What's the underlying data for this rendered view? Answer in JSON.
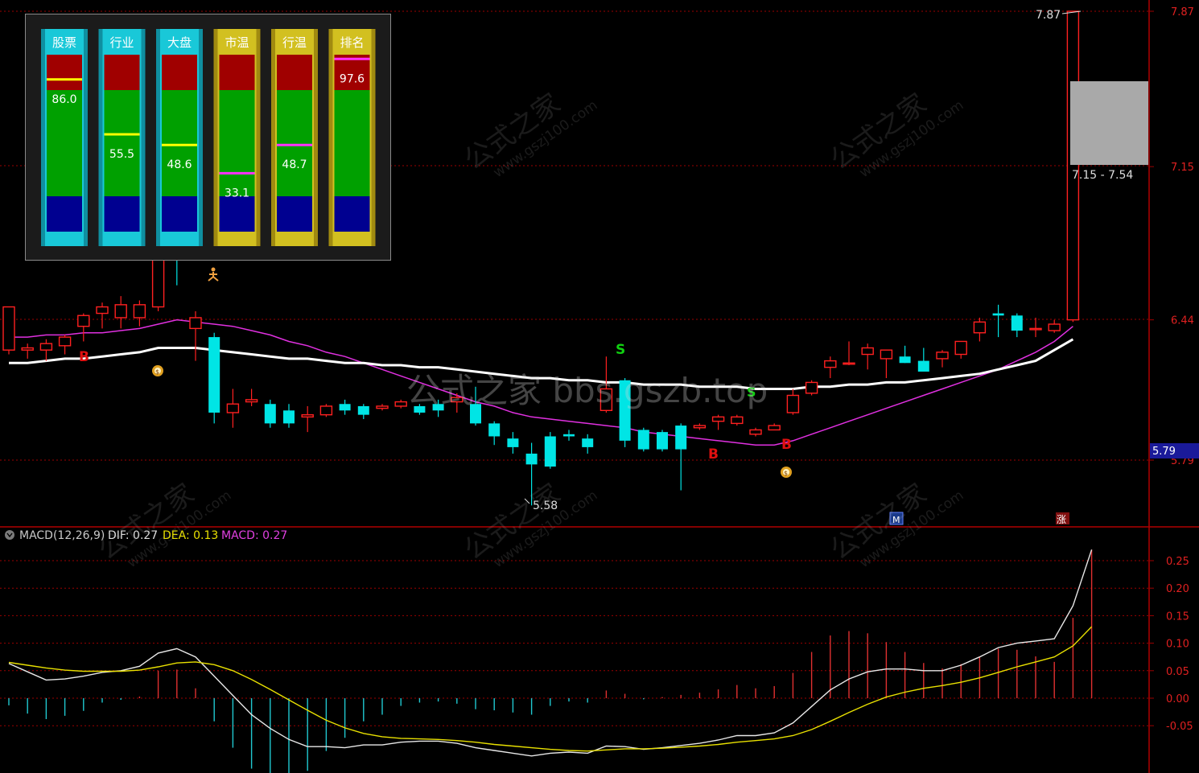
{
  "colors": {
    "background": "#000000",
    "up": "#ff2020",
    "down": "#00e5e5",
    "grid": "#9b0000",
    "ma_white": "#ffffff",
    "ma_magenta": "#e030e0",
    "dea": "#e8e000",
    "macd_label": "#e040e0"
  },
  "price_axis": {
    "ticks": [
      "7.87",
      "7.15",
      "6.44",
      "5.79"
    ],
    "current": "5.79",
    "ylim": [
      5.3,
      7.95
    ]
  },
  "annotations": {
    "high": "7.87",
    "range": "7.15 - 7.54",
    "low": "5.58",
    "zhang": "涨",
    "m_marker": "M"
  },
  "signals": [
    "B",
    "B",
    "B",
    "S",
    "S"
  ],
  "gauges": [
    {
      "label": "股票",
      "value": "86.0",
      "theme": "cyan",
      "level": 0.86,
      "line": "yellow"
    },
    {
      "label": "行业",
      "value": "55.5",
      "theme": "cyan",
      "level": 0.55,
      "line": "yellow"
    },
    {
      "label": "大盘",
      "value": "48.6",
      "theme": "cyan",
      "level": 0.49,
      "line": "yellow"
    },
    {
      "label": "市温",
      "value": "33.1",
      "theme": "gold",
      "level": 0.33,
      "line": "magenta"
    },
    {
      "label": "行温",
      "value": "48.7",
      "theme": "gold",
      "level": 0.49,
      "line": "magenta"
    },
    {
      "label": "排名",
      "value": "97.6",
      "theme": "gold",
      "level": 0.976,
      "line": "magenta"
    }
  ],
  "macd_header": {
    "name": "MACD(12,26,9)",
    "dif": "DIF: 0.27",
    "dea": "DEA: 0.13",
    "macd": "MACD: 0.27"
  },
  "macd_axis": {
    "ticks": [
      "0.25",
      "0.20",
      "0.15",
      "0.10",
      "0.05",
      "0.00",
      "-0.05"
    ],
    "ylim": [
      -0.13,
      0.29
    ]
  },
  "watermark": {
    "cn": "公式之家",
    "url": "www.gszj100.com",
    "center": "公式之家 bbs.gszb.top"
  },
  "chart_data": [
    {
      "type": "candlestick",
      "x": [
        1,
        2,
        3,
        4,
        5,
        6,
        7,
        8,
        9,
        10,
        11,
        12,
        13,
        14,
        15,
        16,
        17,
        18,
        19,
        20,
        21,
        22,
        23,
        24,
        25,
        26,
        27,
        28,
        29,
        30,
        31,
        32,
        33,
        34,
        35,
        36,
        37,
        38,
        39,
        40,
        41,
        42,
        43,
        44,
        45,
        46,
        47,
        48,
        49,
        50,
        51,
        52,
        53,
        54,
        55,
        56,
        57,
        58
      ],
      "ohlc": [
        [
          6.3,
          6.5,
          6.28,
          6.5
        ],
        [
          6.3,
          6.33,
          6.26,
          6.31
        ],
        [
          6.3,
          6.35,
          6.25,
          6.33
        ],
        [
          6.32,
          6.37,
          6.28,
          6.36
        ],
        [
          6.41,
          6.47,
          6.34,
          6.46
        ],
        [
          6.47,
          6.52,
          6.4,
          6.5
        ],
        [
          6.45,
          6.55,
          6.4,
          6.51
        ],
        [
          6.45,
          6.53,
          6.41,
          6.51
        ],
        [
          6.5,
          6.9,
          6.48,
          6.85
        ],
        [
          6.82,
          6.88,
          6.6,
          6.8
        ],
        [
          6.4,
          6.48,
          6.25,
          6.45
        ],
        [
          6.36,
          6.38,
          5.96,
          6.01
        ],
        [
          6.01,
          6.12,
          5.94,
          6.05
        ],
        [
          6.06,
          6.12,
          6.04,
          6.07
        ],
        [
          6.05,
          6.07,
          5.94,
          5.96
        ],
        [
          6.02,
          6.05,
          5.94,
          5.96
        ],
        [
          5.99,
          6.04,
          5.92,
          6.0
        ],
        [
          6.0,
          6.05,
          5.99,
          6.04
        ],
        [
          6.05,
          6.07,
          6.0,
          6.02
        ],
        [
          6.04,
          6.05,
          5.98,
          6.0
        ],
        [
          6.03,
          6.05,
          6.02,
          6.04
        ],
        [
          6.04,
          6.07,
          6.03,
          6.06
        ],
        [
          6.04,
          6.05,
          6.0,
          6.01
        ],
        [
          6.05,
          6.07,
          5.99,
          6.02
        ],
        [
          6.06,
          6.1,
          6.01,
          6.08
        ],
        [
          6.05,
          6.13,
          5.95,
          5.96
        ],
        [
          5.96,
          5.97,
          5.86,
          5.9
        ],
        [
          5.89,
          5.92,
          5.82,
          5.85
        ],
        [
          5.82,
          5.87,
          5.58,
          5.77
        ],
        [
          5.9,
          5.92,
          5.75,
          5.76
        ],
        [
          5.91,
          5.93,
          5.88,
          5.9
        ],
        [
          5.89,
          5.91,
          5.82,
          5.85
        ],
        [
          6.02,
          6.27,
          6.01,
          6.12
        ],
        [
          6.16,
          6.17,
          5.85,
          5.88
        ],
        [
          5.93,
          5.94,
          5.83,
          5.84
        ],
        [
          5.92,
          5.93,
          5.83,
          5.84
        ],
        [
          5.95,
          5.96,
          5.65,
          5.84
        ],
        [
          5.94,
          5.96,
          5.93,
          5.95
        ],
        [
          5.97,
          6.0,
          5.93,
          5.99
        ],
        [
          5.96,
          6.0,
          5.95,
          5.99
        ],
        [
          5.91,
          5.94,
          5.9,
          5.93
        ],
        [
          5.93,
          5.96,
          5.93,
          5.95
        ],
        [
          6.01,
          6.12,
          6.0,
          6.09
        ],
        [
          6.1,
          6.16,
          6.09,
          6.15
        ],
        [
          6.22,
          6.27,
          6.17,
          6.25
        ],
        [
          6.24,
          6.34,
          6.23,
          6.24
        ],
        [
          6.28,
          6.33,
          6.21,
          6.31
        ],
        [
          6.26,
          6.3,
          6.17,
          6.3
        ],
        [
          6.27,
          6.32,
          6.24,
          6.24
        ],
        [
          6.25,
          6.31,
          6.2,
          6.2
        ],
        [
          6.26,
          6.3,
          6.22,
          6.29
        ],
        [
          6.28,
          6.34,
          6.26,
          6.34
        ],
        [
          6.38,
          6.45,
          6.34,
          6.43
        ],
        [
          6.47,
          6.51,
          6.36,
          6.46
        ],
        [
          6.46,
          6.47,
          6.36,
          6.39
        ],
        [
          6.4,
          6.45,
          6.36,
          6.4
        ],
        [
          6.39,
          6.44,
          6.38,
          6.42
        ],
        [
          6.44,
          7.87,
          6.43,
          7.87
        ]
      ],
      "ma_white": [
        6.24,
        6.24,
        6.25,
        6.26,
        6.26,
        6.27,
        6.28,
        6.29,
        6.31,
        6.31,
        6.31,
        6.3,
        6.29,
        6.28,
        6.27,
        6.26,
        6.26,
        6.25,
        6.24,
        6.24,
        6.23,
        6.23,
        6.22,
        6.22,
        6.21,
        6.2,
        6.19,
        6.18,
        6.17,
        6.17,
        6.16,
        6.16,
        6.15,
        6.15,
        6.14,
        6.14,
        6.14,
        6.13,
        6.13,
        6.13,
        6.12,
        6.12,
        6.12,
        6.13,
        6.13,
        6.14,
        6.14,
        6.15,
        6.15,
        6.16,
        6.17,
        6.18,
        6.19,
        6.21,
        6.23,
        6.25,
        6.3,
        6.35
      ],
      "ma_magenta": [
        6.36,
        6.36,
        6.37,
        6.37,
        6.38,
        6.38,
        6.39,
        6.4,
        6.42,
        6.44,
        6.43,
        6.42,
        6.41,
        6.39,
        6.37,
        6.34,
        6.32,
        6.29,
        6.27,
        6.24,
        6.21,
        6.18,
        6.15,
        6.12,
        6.09,
        6.06,
        6.04,
        6.01,
        5.99,
        5.98,
        5.97,
        5.96,
        5.95,
        5.94,
        5.92,
        5.91,
        5.9,
        5.89,
        5.88,
        5.87,
        5.86,
        5.86,
        5.88,
        5.91,
        5.94,
        5.97,
        6.0,
        6.03,
        6.06,
        6.09,
        6.12,
        6.15,
        6.18,
        6.21,
        6.25,
        6.29,
        6.34,
        6.41
      ]
    },
    {
      "type": "macd",
      "x": [
        1,
        2,
        3,
        4,
        5,
        6,
        7,
        8,
        9,
        10,
        11,
        12,
        13,
        14,
        15,
        16,
        17,
        18,
        19,
        20,
        21,
        22,
        23,
        24,
        25,
        26,
        27,
        28,
        29,
        30,
        31,
        32,
        33,
        34,
        35,
        36,
        37,
        38,
        39,
        40,
        41,
        42,
        43,
        44,
        45,
        46,
        47,
        48,
        49,
        50,
        51,
        52,
        53,
        54,
        55,
        56,
        57,
        58
      ],
      "dif": [
        0.063,
        0.048,
        0.033,
        0.035,
        0.04,
        0.047,
        0.05,
        0.058,
        0.082,
        0.09,
        0.075,
        0.04,
        0.005,
        -0.03,
        -0.055,
        -0.075,
        -0.088,
        -0.088,
        -0.09,
        -0.085,
        -0.085,
        -0.08,
        -0.078,
        -0.078,
        -0.082,
        -0.09,
        -0.095,
        -0.1,
        -0.105,
        -0.1,
        -0.098,
        -0.1,
        -0.087,
        -0.088,
        -0.093,
        -0.09,
        -0.086,
        -0.082,
        -0.076,
        -0.068,
        -0.068,
        -0.063,
        -0.045,
        -0.015,
        0.015,
        0.035,
        0.048,
        0.053,
        0.053,
        0.05,
        0.05,
        0.06,
        0.075,
        0.092,
        0.1,
        0.104,
        0.108,
        0.168,
        0.27
      ],
      "dea": [
        0.065,
        0.06,
        0.055,
        0.051,
        0.049,
        0.049,
        0.049,
        0.051,
        0.057,
        0.064,
        0.066,
        0.061,
        0.05,
        0.034,
        0.016,
        -0.003,
        -0.022,
        -0.04,
        -0.054,
        -0.064,
        -0.07,
        -0.073,
        -0.074,
        -0.075,
        -0.077,
        -0.08,
        -0.084,
        -0.087,
        -0.09,
        -0.093,
        -0.095,
        -0.096,
        -0.094,
        -0.092,
        -0.092,
        -0.091,
        -0.089,
        -0.087,
        -0.084,
        -0.08,
        -0.077,
        -0.074,
        -0.068,
        -0.057,
        -0.042,
        -0.026,
        -0.011,
        0.002,
        0.011,
        0.018,
        0.023,
        0.029,
        0.037,
        0.047,
        0.057,
        0.066,
        0.075,
        0.095,
        0.13
      ],
      "macd": [
        -0.013,
        -0.028,
        -0.038,
        -0.032,
        -0.023,
        -0.008,
        -0.003,
        0.003,
        0.05,
        0.052,
        0.018,
        -0.042,
        -0.09,
        -0.128,
        -0.142,
        -0.144,
        -0.132,
        -0.096,
        -0.072,
        -0.042,
        -0.03,
        -0.014,
        -0.008,
        -0.006,
        -0.01,
        -0.02,
        -0.022,
        -0.026,
        -0.03,
        -0.014,
        -0.006,
        -0.008,
        0.014,
        0.008,
        -0.002,
        0.002,
        0.006,
        0.01,
        0.016,
        0.024,
        0.018,
        0.022,
        0.046,
        0.084,
        0.114,
        0.122,
        0.118,
        0.102,
        0.084,
        0.064,
        0.054,
        0.062,
        0.076,
        0.09,
        0.088,
        0.076,
        0.066,
        0.146,
        0.27
      ]
    }
  ]
}
